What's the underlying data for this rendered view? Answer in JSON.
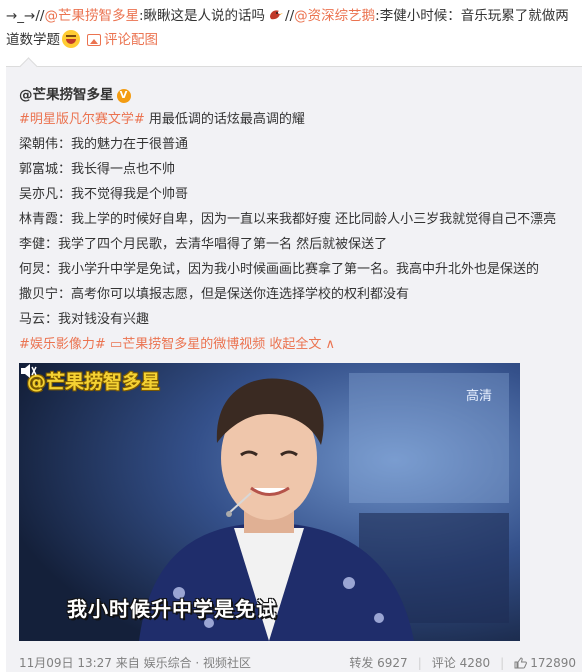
{
  "repost": {
    "arrow_prefix": "→_→//",
    "user1": "@芒果捞智多星",
    "text1": ":瞅瞅这是人说的话吗",
    "sep2": "//",
    "user2": "@资深综艺鹅",
    "text2": ":李健小时候：音乐玩累了就做两道数学题",
    "comment_image_label": "评论配图"
  },
  "original": {
    "author": "@芒果捞智多星",
    "verified_badge": "V",
    "lines": [
      {
        "tag": "#明星版凡尔赛文学#",
        "text": " 用最低调的话炫最高调的耀"
      },
      {
        "speaker": "梁朝伟",
        "text": "：我的魅力在于很普通"
      },
      {
        "speaker": "郭富城",
        "text": "：我长得一点也不帅"
      },
      {
        "speaker": "吴亦凡",
        "text": "：我不觉得我是个帅哥"
      },
      {
        "speaker": "林青霞",
        "text": "：我上学的时候好自卑，因为一直以来我都好瘦 还比同龄人小三岁我就觉得自己不漂亮"
      },
      {
        "speaker": "李健",
        "text": "：我学了四个月民歌，去清华唱得了第一名 然后就被保送了"
      },
      {
        "speaker": "何炅",
        "text": "：我小学升中学是免试，因为我小时候画画比赛拿了第一名。我高中升北外也是保送的"
      },
      {
        "speaker": "撒贝宁",
        "text": "：高考你可以填报志愿，但是保送你连选择学校的权利都没有"
      },
      {
        "speaker": "马云",
        "text": "：我对钱没有兴趣"
      }
    ],
    "tag_line": {
      "tag": "#娱乐影像力#",
      "video_link": "芒果捞智多星的微博视频",
      "collapse": "收起全文"
    }
  },
  "video": {
    "watermark": "@芒果捞智多星",
    "quality": "高清",
    "subtitle": "我小时候升中学是免试"
  },
  "footer": {
    "date": "11月09日 13:27",
    "source": "来自 娱乐综合 · 视频社区",
    "repost_label": "转发",
    "repost_count": "6927",
    "comment_label": "评论",
    "comment_count": "4280",
    "like_count": "172890"
  },
  "colors": {
    "link": "#eb7350",
    "card_bg": "#f2f2f5",
    "text": "#333333",
    "muted": "#808080"
  }
}
